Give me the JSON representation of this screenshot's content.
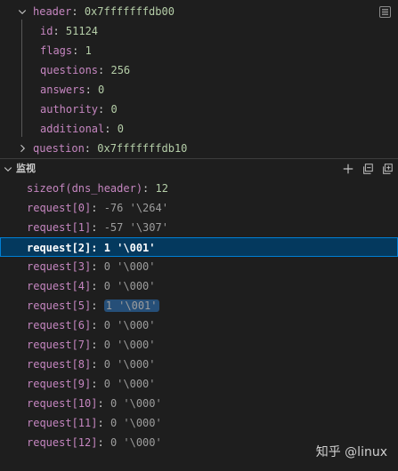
{
  "variables": {
    "header": {
      "name": "header",
      "value": "0x7fffffffdb00",
      "children": [
        {
          "name": "id",
          "value": "51124"
        },
        {
          "name": "flags",
          "value": "1"
        },
        {
          "name": "questions",
          "value": "256"
        },
        {
          "name": "answers",
          "value": "0"
        },
        {
          "name": "authority",
          "value": "0"
        },
        {
          "name": "additional",
          "value": "0"
        }
      ]
    },
    "question": {
      "name": "question",
      "value": "0x7fffffffdb10"
    }
  },
  "watch": {
    "title": "监视",
    "items": [
      {
        "expr": "sizeof(dns_header)",
        "value": "12"
      },
      {
        "expr": "request[0]",
        "value": "-76 '\\264'"
      },
      {
        "expr": "request[1]",
        "value": "-57 '\\307'"
      },
      {
        "expr": "request[2]",
        "value": "1 '\\001'"
      },
      {
        "expr": "request[3]",
        "value": "0 '\\000'"
      },
      {
        "expr": "request[4]",
        "value": "0 '\\000'"
      },
      {
        "expr": "request[5]",
        "value": "1 '\\001'"
      },
      {
        "expr": "request[6]",
        "value": "0 '\\000'"
      },
      {
        "expr": "request[7]",
        "value": "0 '\\000'"
      },
      {
        "expr": "request[8]",
        "value": "0 '\\000'"
      },
      {
        "expr": "request[9]",
        "value": "0 '\\000'"
      },
      {
        "expr": "request[10]",
        "value": "0 '\\000'"
      },
      {
        "expr": "request[11]",
        "value": "0 '\\000'"
      },
      {
        "expr": "request[12]",
        "value": "0 '\\000'"
      }
    ]
  },
  "watermark": "知乎 @linux",
  "colors": {
    "key": "#c586c0",
    "number": "#b5cea8",
    "selection": "#04395e",
    "focus_border": "#007fd4",
    "changed_value": "#264f78"
  },
  "icons": [
    "chevron-down-icon",
    "chevron-right-icon",
    "add-icon",
    "collapse-all-icon",
    "expand-all-icon",
    "sticky-scroll-icon"
  ]
}
